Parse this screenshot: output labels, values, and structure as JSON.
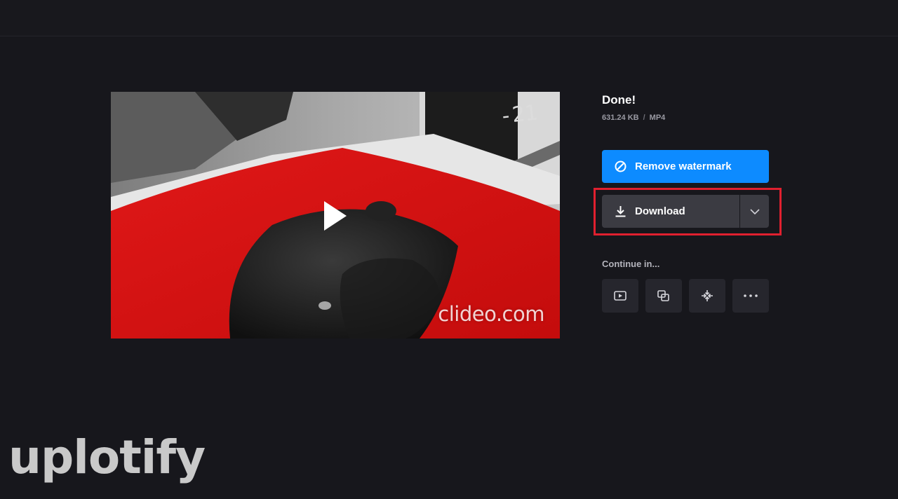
{
  "result": {
    "title": "Done!",
    "file_size": "631.24 KB",
    "separator": "/",
    "format": "MP4"
  },
  "actions": {
    "remove_watermark_label": "Remove watermark",
    "download_label": "Download"
  },
  "continue": {
    "label": "Continue in...",
    "tiles": [
      {
        "icon": "video-player-icon"
      },
      {
        "icon": "merge-icon"
      },
      {
        "icon": "compress-icon"
      },
      {
        "icon": "more-icon"
      }
    ]
  },
  "video": {
    "watermark": "clideo.com"
  },
  "branding": {
    "logo_text": "uplotify"
  },
  "colors": {
    "background": "#17171c",
    "accent_blue": "#0d8bff",
    "button_dark": "#3b3b42",
    "highlight_red": "#e0202f"
  }
}
